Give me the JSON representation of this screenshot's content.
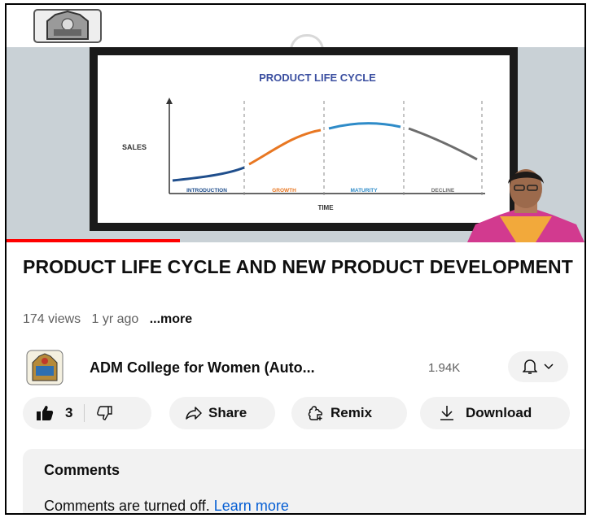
{
  "video": {
    "slide_title": "PRODUCT LIFE CYCLE",
    "y_axis_label": "SALES",
    "x_axis_label": "TIME",
    "stages": [
      "INTRODUCTION",
      "GROWTH",
      "MATURITY",
      "DECLINE"
    ],
    "stage_colors": [
      "#1f4e8c",
      "#e87722",
      "#2e8bc8",
      "#6d6d6d"
    ],
    "progress_fraction": 0.3
  },
  "title": "PRODUCT LIFE CYCLE AND NEW PRODUCT DEVELOPMENT",
  "meta": {
    "views": "174 views",
    "age": "1 yr ago",
    "more": "...more"
  },
  "channel": {
    "name": "ADM College for Women (Auto...",
    "subscribers": "1.94K",
    "bell_icon": "bell-icon"
  },
  "actions": {
    "like_count": "3",
    "share": "Share",
    "remix": "Remix",
    "download": "Download"
  },
  "comments": {
    "heading": "Comments",
    "status": "Comments are turned off.",
    "link": "Learn more"
  }
}
